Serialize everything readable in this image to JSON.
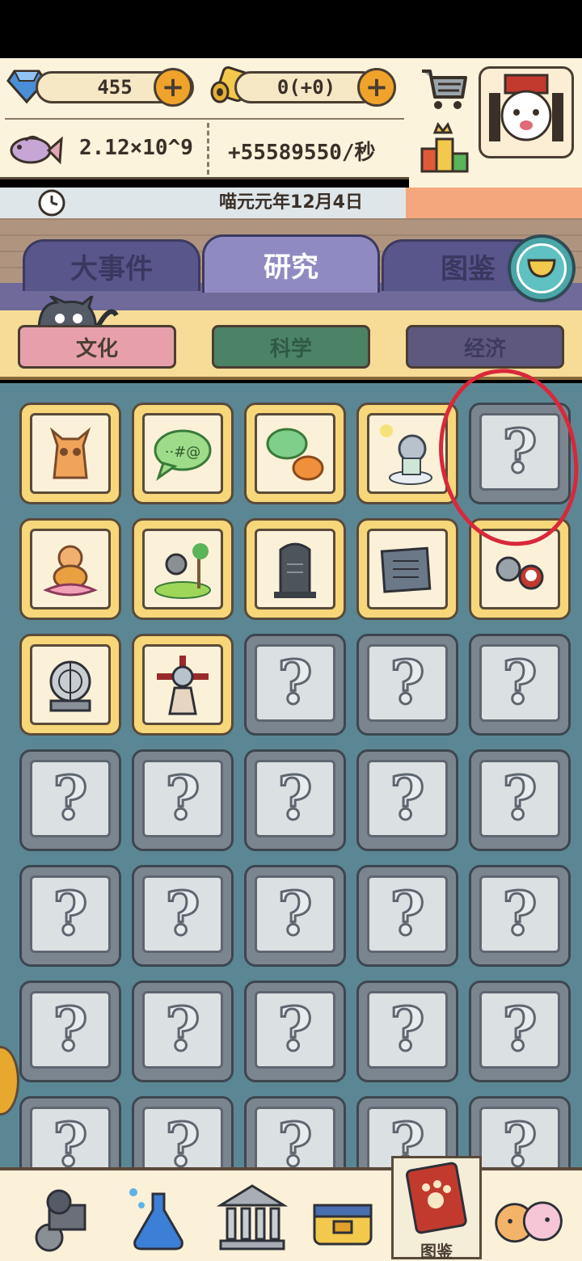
{
  "resources": {
    "gems": "455",
    "scrolls": "0(+0)",
    "fish_total": "2.12×10^9",
    "fish_rate": "+55589550/秒",
    "plus": "+"
  },
  "date": "喵元元年12月4日",
  "tabs": [
    {
      "label": "大事件",
      "active": false
    },
    {
      "label": "研究",
      "active": true
    },
    {
      "label": "图鉴",
      "active": false
    }
  ],
  "categories": [
    {
      "label": "文化",
      "active": true
    },
    {
      "label": "科学",
      "active": false
    },
    {
      "label": "经济",
      "active": false
    }
  ],
  "grid": {
    "columns": 5,
    "cells": [
      {
        "state": "known",
        "icon": "cat-statue-icon"
      },
      {
        "state": "known",
        "icon": "speech-bubble-icon",
        "text": "··#@"
      },
      {
        "state": "known",
        "icon": "cat-speech-icon"
      },
      {
        "state": "known",
        "icon": "cloud-cat-icon"
      },
      {
        "state": "locked",
        "text": "?"
      },
      {
        "state": "known",
        "icon": "lotus-cat-icon"
      },
      {
        "state": "known",
        "icon": "fishing-cat-icon"
      },
      {
        "state": "known",
        "icon": "stele-icon"
      },
      {
        "state": "known",
        "icon": "scroll-tablet-icon"
      },
      {
        "state": "known",
        "icon": "opera-cats-icon"
      },
      {
        "state": "known",
        "icon": "seismograph-icon"
      },
      {
        "state": "known",
        "icon": "official-cat-icon"
      },
      {
        "state": "locked",
        "text": "?"
      },
      {
        "state": "locked",
        "text": "?"
      },
      {
        "state": "locked",
        "text": "?"
      },
      {
        "state": "locked",
        "text": "?"
      },
      {
        "state": "locked",
        "text": "?"
      },
      {
        "state": "locked",
        "text": "?"
      },
      {
        "state": "locked",
        "text": "?"
      },
      {
        "state": "locked",
        "text": "?"
      },
      {
        "state": "locked",
        "text": "?"
      },
      {
        "state": "locked",
        "text": "?"
      },
      {
        "state": "locked",
        "text": "?"
      },
      {
        "state": "locked",
        "text": "?"
      },
      {
        "state": "locked",
        "text": "?"
      },
      {
        "state": "locked",
        "text": "?"
      },
      {
        "state": "locked",
        "text": "?"
      },
      {
        "state": "locked",
        "text": "?"
      },
      {
        "state": "locked",
        "text": "?"
      },
      {
        "state": "locked",
        "text": "?"
      },
      {
        "state": "locked",
        "text": "?"
      },
      {
        "state": "locked",
        "text": "?"
      },
      {
        "state": "locked",
        "text": "?"
      },
      {
        "state": "locked",
        "text": "?"
      },
      {
        "state": "locked",
        "text": "?"
      }
    ]
  },
  "bottom_nav": [
    {
      "icon": "cart-cat-icon"
    },
    {
      "icon": "potion-icon"
    },
    {
      "icon": "museum-icon"
    },
    {
      "icon": "treasure-box-icon"
    },
    {
      "icon": "catalog-book-icon",
      "label": "图鉴",
      "active": true
    },
    {
      "icon": "cats-group-icon"
    }
  ],
  "colors": {
    "annotation_circle": "#d8283a",
    "active_tab": "#8f8bc2",
    "grid_bg": "#5b8795"
  }
}
